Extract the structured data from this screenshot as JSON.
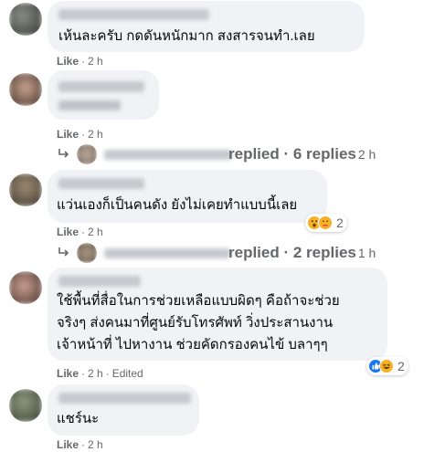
{
  "comments": [
    {
      "text_lines": [
        "เห้นละครับ กดดันหนักมาก สงสารจนทำ.เลย"
      ],
      "like_label": "Like",
      "time": "2 h"
    },
    {
      "text_lines": [],
      "like_label": "Like",
      "time": "2 h",
      "replies": {
        "label": "replied",
        "count_label": "6 replies",
        "time": "2 h"
      }
    },
    {
      "text_lines": [
        "แว่นเองก็เป็นคนดัง ยังไม่เคยทำแบบนี้เลย"
      ],
      "like_label": "Like",
      "time": "2 h",
      "reactions": {
        "icons": [
          "wow-icon",
          "care-icon"
        ],
        "count": "2"
      },
      "replies": {
        "label": "replied",
        "count_label": "2 replies",
        "time": "1 h"
      }
    },
    {
      "text_lines": [
        "ใช้พื้นที่สื่อในการช่วยเหลือแบบผิดๆ คือถ้าจะช่วย",
        "จริงๆ ส่งคนมาที่ศูนย์รับโทรศัพท์ วิ่งประสานงาน",
        "เจ้าหน้าที่ ไปหางาน ช่วยคัดกรองคนไข้ บลาๆๆ"
      ],
      "like_label": "Like",
      "time": "2 h",
      "edited": "Edited",
      "reactions": {
        "icons": [
          "like-icon",
          "haha-icon"
        ],
        "count": "2"
      }
    },
    {
      "text_lines": [
        "แชร์นะ"
      ],
      "like_label": "Like",
      "time": "2 h"
    }
  ],
  "colors": {
    "bubble": "#f0f2f5",
    "meta": "#65676b",
    "text": "#050505",
    "like_blue": "#1877f2",
    "reaction_yellow": "#f7b125"
  }
}
